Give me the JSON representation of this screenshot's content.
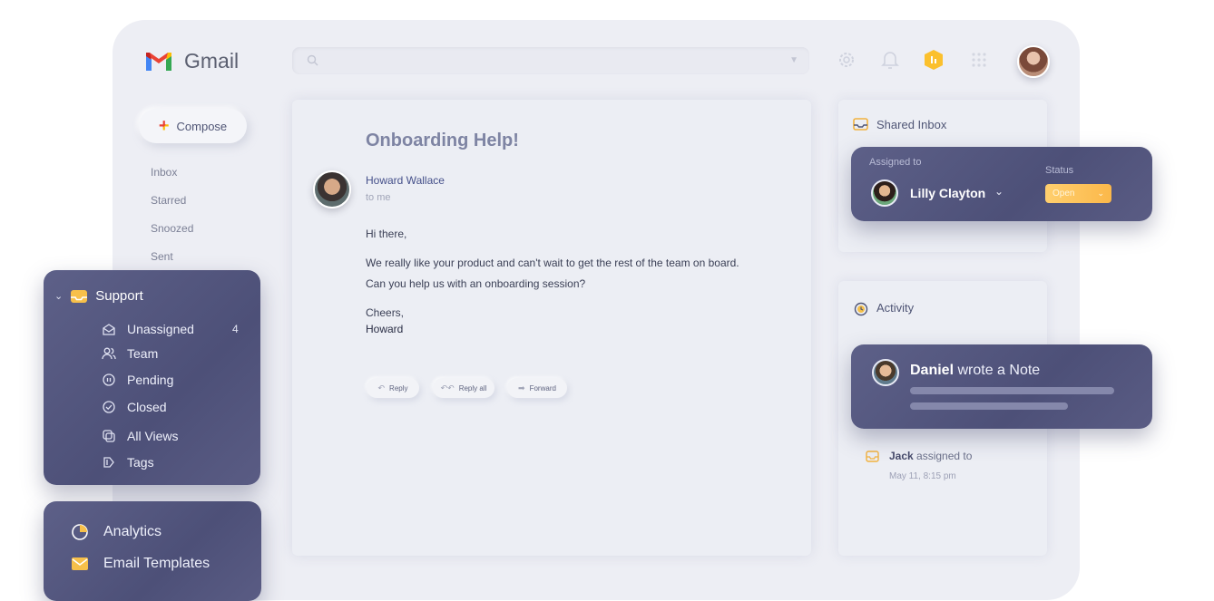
{
  "app": {
    "title": "Gmail"
  },
  "search": {
    "placeholder": ""
  },
  "compose": {
    "label": "Compose"
  },
  "nav": [
    "Inbox",
    "Starred",
    "Snoozed",
    "Sent"
  ],
  "email": {
    "subject": "Onboarding Help!",
    "sender": "Howard Wallace",
    "to": "to me",
    "greeting": "Hi there,",
    "line1": "We really like your product and can't wait to get the rest of the team on board.",
    "line2": "Can you help us with an onboarding session?",
    "signoff": "Cheers,",
    "signature": "Howard",
    "actions": {
      "reply": "Reply",
      "reply_all": "Reply all",
      "forward": "Forward"
    }
  },
  "shared_inbox": {
    "title": "Shared Inbox",
    "assigned_label": "Assigned to",
    "assignee": "Lilly Clayton",
    "status_label": "Status",
    "status_value": "Open"
  },
  "activity": {
    "title": "Activity",
    "note_author": "Daniel",
    "note_text": "wrote a Note",
    "event_user": "Jack",
    "event_text": "assigned to",
    "event_time": "May 11, 8:15 pm"
  },
  "support": {
    "title": "Support",
    "items": [
      {
        "label": "Unassigned",
        "icon": "envelope-open-icon",
        "count": "4"
      },
      {
        "label": "Team",
        "icon": "people-icon"
      },
      {
        "label": "Pending",
        "icon": "pause-circle-icon"
      },
      {
        "label": "Closed",
        "icon": "check-circle-icon"
      },
      {
        "label": "All Views",
        "icon": "copy-icon"
      },
      {
        "label": "Tags",
        "icon": "tag-icon"
      }
    ]
  },
  "bottom_nav": {
    "analytics": "Analytics",
    "templates": "Email Templates"
  },
  "colors": {
    "accent": "#545780",
    "status": "#fbb84a",
    "sender": "#45508a"
  }
}
